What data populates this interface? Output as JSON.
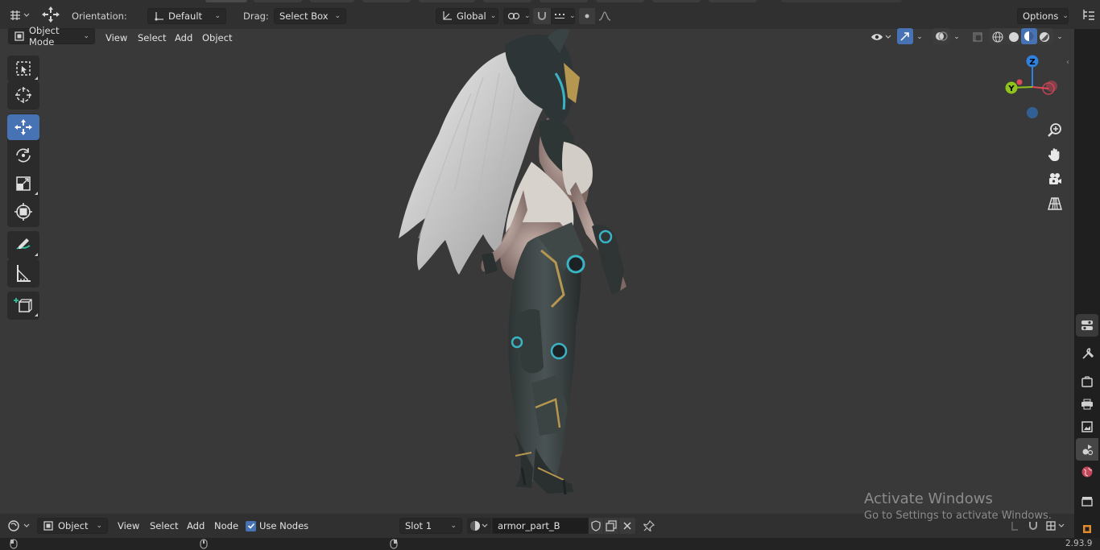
{
  "top_header": {
    "orientation_label": "Orientation:",
    "orientation_value": "Default",
    "drag_label": "Drag:",
    "drag_value": "Select Box",
    "transform_space": "Global",
    "options_label": "Options"
  },
  "viewport_header": {
    "mode": "Object Mode",
    "menus": [
      "View",
      "Select",
      "Add",
      "Object"
    ]
  },
  "toolbar": {
    "tools": [
      {
        "name": "select-box",
        "icon": "select-box-icon"
      },
      {
        "name": "cursor",
        "icon": "cursor-icon"
      },
      {
        "name": "move",
        "icon": "move-icon",
        "active": true
      },
      {
        "name": "rotate",
        "icon": "rotate-icon"
      },
      {
        "name": "scale",
        "icon": "scale-icon"
      },
      {
        "name": "transform",
        "icon": "transform-icon"
      },
      {
        "name": "annotate",
        "icon": "annotate-icon"
      },
      {
        "name": "measure",
        "icon": "measure-icon"
      },
      {
        "name": "add-cube",
        "icon": "add-cube-icon"
      }
    ]
  },
  "gizmo": {
    "z_label": "Z",
    "y_label": "Y",
    "colors": {
      "x": "#e0485a",
      "y": "#8fc21b",
      "z": "#2e82df"
    }
  },
  "bottom_header": {
    "editor_mode": "Object",
    "menus": [
      "View",
      "Select",
      "Add",
      "Node"
    ],
    "use_nodes_label": "Use Nodes",
    "use_nodes_checked": true,
    "slot_value": "Slot 1",
    "material_name": "armor_part_B"
  },
  "watermark": {
    "line1": "Activate Windows",
    "line2": "Go to Settings to activate Windows."
  },
  "status_bar": {
    "version": "2.93.9"
  },
  "colors": {
    "accent": "#4772b3",
    "viewport_bg": "#393939",
    "header_bg": "#303030"
  }
}
